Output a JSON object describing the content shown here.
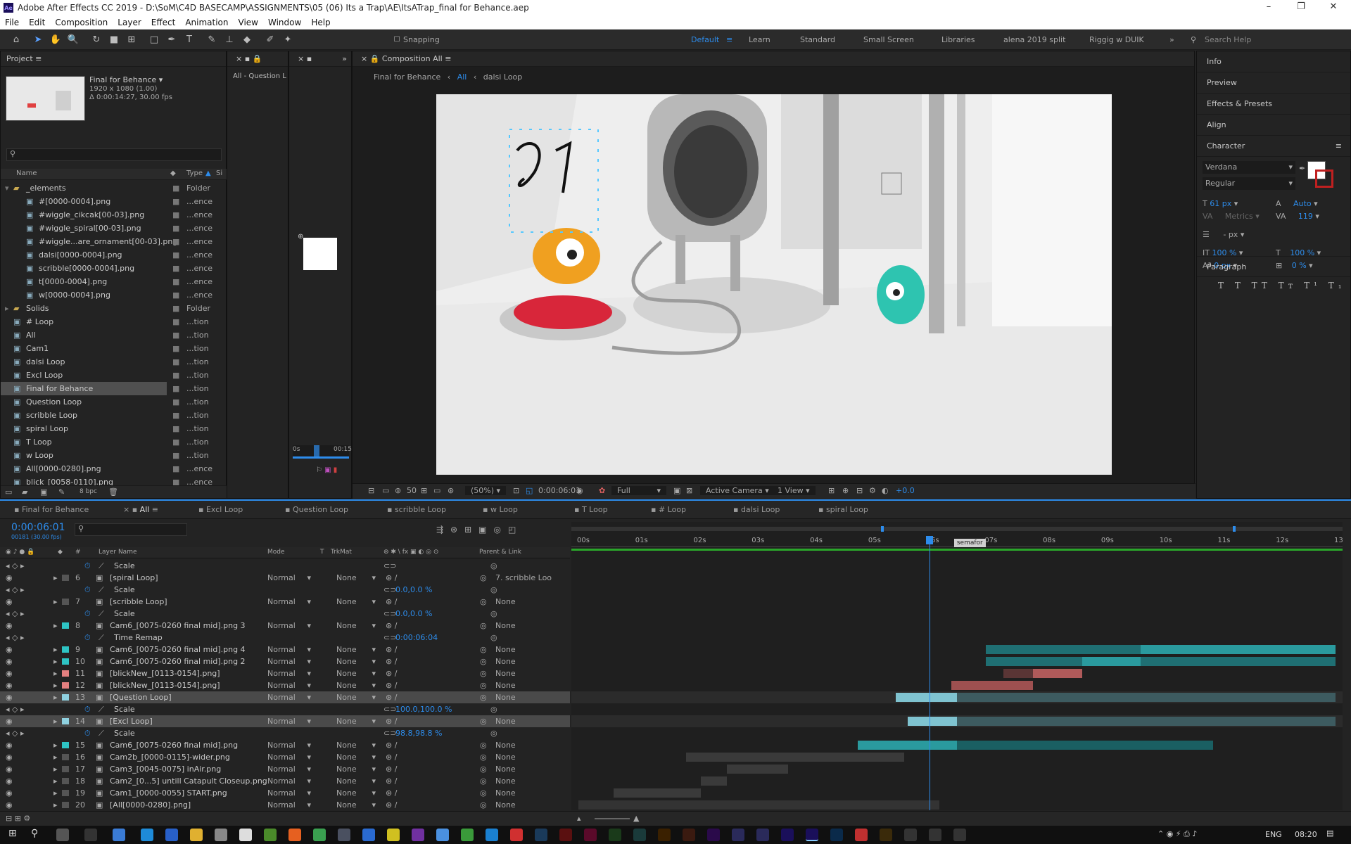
{
  "window": {
    "title": "Adobe After Effects CC 2019 - D:\\SoM\\C4D BASECAMP\\ASSIGNMENTS\\05 (06) Its a Trap\\AE\\ItsATrap_final for Behance.aep"
  },
  "menu": [
    "File",
    "Edit",
    "Composition",
    "Layer",
    "Effect",
    "Animation",
    "View",
    "Window",
    "Help"
  ],
  "toolbar": {
    "snapping": "Snapping",
    "workspaces": [
      "Default",
      "Learn",
      "Standard",
      "Small Screen",
      "Libraries",
      "alena 2019 split",
      "Riggig w DUIK"
    ],
    "search_placeholder": "Search Help"
  },
  "project": {
    "title": "Project",
    "comp_name": "Final for Behance",
    "comp_info1": "1920 x 1080 (1.00)",
    "comp_info2": "Δ 0:00:14:27, 30.00 fps",
    "search_placeholder": "",
    "col_name": "Name",
    "col_type": "Type",
    "col_size": "Si",
    "bpc": "8 bpc",
    "items": [
      {
        "name": "_elements",
        "type": "Folder",
        "indent": 0,
        "kind": "folder"
      },
      {
        "name": "#[0000-0004].png",
        "type": "...ence",
        "indent": 1,
        "kind": "seq"
      },
      {
        "name": "#wiggle_cikcak[00-03].png",
        "type": "...ence",
        "indent": 1,
        "kind": "seq"
      },
      {
        "name": "#wiggle_spiral[00-03].png",
        "type": "...ence",
        "indent": 1,
        "kind": "seq"
      },
      {
        "name": "#wiggle...are_ornament[00-03].png",
        "type": "...ence",
        "indent": 1,
        "kind": "seq"
      },
      {
        "name": "dalsi[0000-0004].png",
        "type": "...ence",
        "indent": 1,
        "kind": "seq"
      },
      {
        "name": "scribble[0000-0004].png",
        "type": "...ence",
        "indent": 1,
        "kind": "seq"
      },
      {
        "name": "t[0000-0004].png",
        "type": "...ence",
        "indent": 1,
        "kind": "seq"
      },
      {
        "name": "w[0000-0004].png",
        "type": "...ence",
        "indent": 1,
        "kind": "seq"
      },
      {
        "name": "Solids",
        "type": "Folder",
        "indent": 0,
        "kind": "folder"
      },
      {
        "name": "# Loop",
        "type": "...tion",
        "indent": 0,
        "kind": "comp"
      },
      {
        "name": "All",
        "type": "...tion",
        "indent": 0,
        "kind": "comp"
      },
      {
        "name": "Cam1",
        "type": "...tion",
        "indent": 0,
        "kind": "comp"
      },
      {
        "name": "dalsi Loop",
        "type": "...tion",
        "indent": 0,
        "kind": "comp"
      },
      {
        "name": "Excl Loop",
        "type": "...tion",
        "indent": 0,
        "kind": "comp"
      },
      {
        "name": "Final for Behance",
        "type": "...tion",
        "indent": 0,
        "kind": "comp"
      },
      {
        "name": "Question Loop",
        "type": "...tion",
        "indent": 0,
        "kind": "comp"
      },
      {
        "name": "scribble Loop",
        "type": "...tion",
        "indent": 0,
        "kind": "comp"
      },
      {
        "name": "spiral Loop",
        "type": "...tion",
        "indent": 0,
        "kind": "comp"
      },
      {
        "name": "T Loop",
        "type": "...tion",
        "indent": 0,
        "kind": "comp"
      },
      {
        "name": "w Loop",
        "type": "...tion",
        "indent": 0,
        "kind": "comp"
      },
      {
        "name": "All[0000-0280].png",
        "type": "...ence",
        "indent": 0,
        "kind": "seq"
      },
      {
        "name": "blick_[0058-0110].png",
        "type": "...ence",
        "indent": 0,
        "kind": "seq"
      }
    ]
  },
  "effects_panel": {
    "tab": "All - Question L"
  },
  "mini_timeline": {
    "start": "0s",
    "end": "00:15"
  },
  "composition": {
    "tab": "Composition All",
    "breadcrumbs": [
      "Final for Behance",
      "All",
      "dalsi Loop"
    ],
    "zoom": "(50%)",
    "timecode": "0:00:06:01",
    "resolution": "Full",
    "camera": "Active Camera",
    "view": "1 View",
    "exposure": "+0.0",
    "zoom_ratio": "50"
  },
  "right_panel": {
    "items": [
      "Info",
      "Preview",
      "Effects & Presets",
      "Align"
    ],
    "character": "Character",
    "font": "Verdana",
    "style": "Regular",
    "size": "61 px",
    "leading": "Auto",
    "kerning": "Metrics",
    "tracking": "119",
    "stroke": "- px",
    "vscale": "100 %",
    "hscale": "100 %",
    "baseline": "0 px",
    "tsume": "0 %",
    "paragraph": "Paragraph"
  },
  "timeline": {
    "tabs": [
      "Final for Behance",
      "All",
      "Excl Loop",
      "Question Loop",
      "scribble Loop",
      "w Loop",
      "T Loop",
      "# Loop",
      "dalsi Loop",
      "spiral Loop"
    ],
    "timecode": "0:00:06:01",
    "frame_info": "00181 (30.00 fps)",
    "headers": {
      "layer_name": "Layer Name",
      "mode": "Mode",
      "t": "T",
      "trkmat": "TrkMat",
      "parent": "Parent & Link"
    },
    "ruler": [
      "00s",
      "01s",
      "02s",
      "03s",
      "04s",
      "05s",
      "06s",
      "07s",
      "08s",
      "09s",
      "10s",
      "11s",
      "12s",
      "13s"
    ],
    "marker": "semafor",
    "playhead_seconds": 6.03,
    "rows": [
      {
        "kind": "prop",
        "name": "Scale",
        "value": ""
      },
      {
        "kind": "layer",
        "num": "6",
        "name": "[spiral Loop]",
        "mode": "Normal",
        "trk": "None",
        "parent": "7. scribble Loo",
        "color": "#555"
      },
      {
        "kind": "prop",
        "name": "Scale",
        "value": "0.0,0.0 %"
      },
      {
        "kind": "layer",
        "num": "7",
        "name": "[scribble Loop]",
        "mode": "Normal",
        "trk": "None",
        "parent": "None",
        "color": "#555"
      },
      {
        "kind": "prop",
        "name": "Scale",
        "value": "0.0,0.0 %"
      },
      {
        "kind": "layer",
        "num": "8",
        "name": "Cam6_[0075-0260 final mid].png 3",
        "mode": "Normal",
        "trk": "None",
        "parent": "None",
        "color": "#2ec4c4"
      },
      {
        "kind": "prop",
        "name": "Time Remap",
        "value": "0:00:06:04"
      },
      {
        "kind": "layer",
        "num": "9",
        "name": "Cam6_[0075-0260 final mid].png 4",
        "mode": "Normal",
        "trk": "None",
        "parent": "None",
        "color": "#2ec4c4"
      },
      {
        "kind": "layer",
        "num": "10",
        "name": "Cam6_[0075-0260 final mid].png 2",
        "mode": "Normal",
        "trk": "None",
        "parent": "None",
        "color": "#2ec4c4"
      },
      {
        "kind": "layer",
        "num": "11",
        "name": "[blickNew_[0113-0154].png]",
        "mode": "Normal",
        "trk": "None",
        "parent": "None",
        "color": "#e58080"
      },
      {
        "kind": "layer",
        "num": "12",
        "name": "[blickNew_[0113-0154].png]",
        "mode": "Normal",
        "trk": "None",
        "parent": "None",
        "color": "#e58080"
      },
      {
        "kind": "layer",
        "num": "13",
        "name": "[Question Loop]",
        "mode": "Normal",
        "trk": "None",
        "parent": "None",
        "color": "#8fd1e0",
        "selected": true
      },
      {
        "kind": "prop",
        "name": "Scale",
        "value": "100.0,100.0 %"
      },
      {
        "kind": "layer",
        "num": "14",
        "name": "[Excl Loop]",
        "mode": "Normal",
        "trk": "None",
        "parent": "None",
        "color": "#8fd1e0",
        "selected": true
      },
      {
        "kind": "prop",
        "name": "Scale",
        "value": "98.8,98.8 %"
      },
      {
        "kind": "layer",
        "num": "15",
        "name": "Cam6_[0075-0260 final mid].png",
        "mode": "Normal",
        "trk": "None",
        "parent": "None",
        "color": "#2ec4c4"
      },
      {
        "kind": "layer",
        "num": "16",
        "name": "Cam2b_[0000-0115]-wider.png",
        "mode": "Normal",
        "trk": "None",
        "parent": "None",
        "color": "#555"
      },
      {
        "kind": "layer",
        "num": "17",
        "name": "Cam3_[0045-0075] inAir.png",
        "mode": "Normal",
        "trk": "None",
        "parent": "None",
        "color": "#555"
      },
      {
        "kind": "layer",
        "num": "18",
        "name": "Cam2_[0...5] untill Catapult Closeup.png",
        "mode": "Normal",
        "trk": "None",
        "parent": "None",
        "color": "#555"
      },
      {
        "kind": "layer",
        "num": "19",
        "name": "Cam1_[0000-0055] START.png",
        "mode": "Normal",
        "trk": "None",
        "parent": "None",
        "color": "#555"
      },
      {
        "kind": "layer",
        "num": "20",
        "name": "[All[0000-0280].png]",
        "mode": "Normal",
        "trk": "None",
        "parent": "None",
        "color": "#555"
      }
    ],
    "bars": [
      {
        "row": 7,
        "start": 7.0,
        "end": 13.0,
        "color": "#1f6f73"
      },
      {
        "row": 7,
        "start": 9.65,
        "end": 13.0,
        "color": "#2a9a9e"
      },
      {
        "row": 8,
        "start": 7.0,
        "end": 13.0,
        "color": "#1f6f73"
      },
      {
        "row": 8,
        "start": 8.65,
        "end": 9.65,
        "color": "#2a9a9e"
      },
      {
        "row": 9,
        "start": 7.3,
        "end": 8.3,
        "color": "#5a3535"
      },
      {
        "row": 9,
        "start": 7.8,
        "end": 8.65,
        "color": "#b05a5a"
      },
      {
        "row": 10,
        "start": 6.4,
        "end": 7.8,
        "color": "#9e5050"
      },
      {
        "row": 11,
        "start": 5.45,
        "end": 13.0,
        "color": "#3d5b60"
      },
      {
        "row": 11,
        "start": 5.45,
        "end": 6.5,
        "color": "#7fc3d0"
      },
      {
        "row": 13,
        "start": 5.65,
        "end": 13.0,
        "color": "#3d5b60"
      },
      {
        "row": 13,
        "start": 5.65,
        "end": 6.5,
        "color": "#7fc3d0"
      },
      {
        "row": 15,
        "start": 4.8,
        "end": 10.9,
        "color": "#1a5f62"
      },
      {
        "row": 15,
        "start": 4.8,
        "end": 6.5,
        "color": "#2a9a9e"
      },
      {
        "row": 16,
        "start": 1.85,
        "end": 5.6,
        "color": "#3a3a3a"
      },
      {
        "row": 17,
        "start": 2.55,
        "end": 3.6,
        "color": "#3a3a3a"
      },
      {
        "row": 18,
        "start": 2.1,
        "end": 2.55,
        "color": "#3a3a3a"
      },
      {
        "row": 19,
        "start": 0.6,
        "end": 2.1,
        "color": "#3a3a3a"
      },
      {
        "row": 20,
        "start": 0.0,
        "end": 6.2,
        "color": "#333"
      }
    ]
  },
  "taskbar": {
    "lang": "ENG",
    "time": "08:20"
  },
  "colors": {
    "accent": "#2d8ceb",
    "panel": "#232323"
  }
}
